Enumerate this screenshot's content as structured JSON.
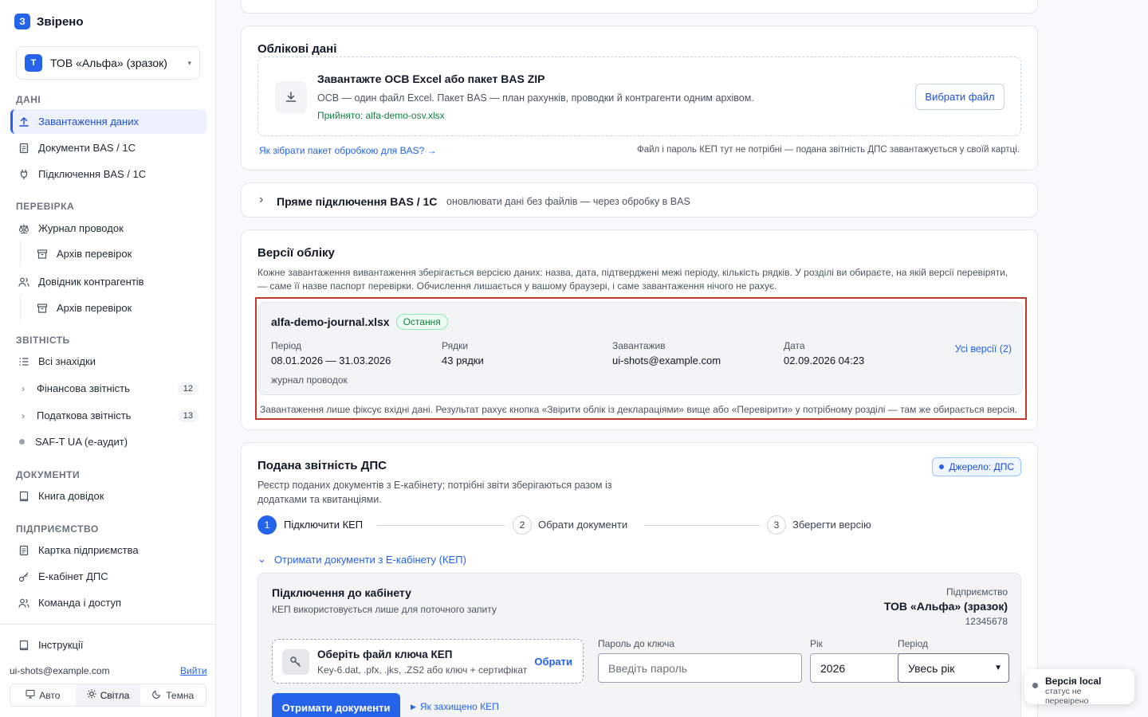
{
  "brand": {
    "logo_letter": "З",
    "name": "Звірено"
  },
  "org": {
    "avatar": "Т",
    "name": "ТОВ «Альфа» (зразок)"
  },
  "sidebar": {
    "sections": {
      "data": "ДАНІ",
      "check": "ПЕРЕВІРКА",
      "reporting": "ЗВІТНІСТЬ",
      "documents": "ДОКУМЕНТИ",
      "company": "ПІДПРИЄМСТВО"
    },
    "items": {
      "upload": "Завантаження даних",
      "bas_docs": "Документи BAS / 1С",
      "bas_connect": "Підключення BAS / 1С",
      "journal": "Журнал проводок",
      "archive1": "Архів перевірок",
      "counterparties": "Довідник контрагентів",
      "archive2": "Архів перевірок",
      "all_findings": "Всі знахідки",
      "financial": "Фінансова звітність",
      "financial_count": "12",
      "tax": "Податкова звітність",
      "tax_count": "13",
      "saft": "SAF-T UA (е-аудит)",
      "book": "Книга довідок",
      "company_card": "Картка підприємства",
      "ecabinet": "Е-кабінет ДПС",
      "team": "Команда і доступ",
      "instructions": "Інструкції"
    },
    "user_email": "ui-shots@example.com",
    "logout": "Вийти",
    "theme": {
      "auto": "Авто",
      "light": "Світла",
      "dark": "Темна"
    }
  },
  "accounting": {
    "title": "Облікові дані",
    "upload_title": "Завантажте ОСВ Excel або пакет BAS ZIP",
    "upload_desc": "ОСВ — один файл Excel. Пакет BAS — план рахунків, проводки й контрагенти одним архівом.",
    "accepted": "Прийнято: alfa-demo-osv.xlsx",
    "choose_file": "Вибрати файл",
    "how_link": "Як зібрати пакет обробкою для BAS? →",
    "note": "Файл і пароль КЕП тут не потрібні — подана звітність ДПС завантажується у своїй картці."
  },
  "direct": {
    "title": "Пряме підключення BAS / 1С",
    "subtitle": "оновлювати дані без файлів — через обробку в BAS"
  },
  "versions": {
    "title": "Версії обліку",
    "desc": "Кожне завантаження вивантаження зберігається версією даних: назва, дата, підтверджені межі періоду, кількість рядків. У розділі ви обираєте, на якій версії перевіряти, — саме її назве паспорт перевірки. Обчислення лишається у вашому браузері, і саме завантаження нічого не рахує.",
    "file": "alfa-demo-journal.xlsx",
    "tag": "Остання",
    "period_label": "Період",
    "period": "08.01.2026 — 31.03.2026",
    "rows_label": "Рядки",
    "rows": "43 рядки",
    "uploader_label": "Завантажив",
    "uploader": "ui-shots@example.com",
    "date_label": "Дата",
    "date": "02.09.2026 04:23",
    "all_versions": "Усі версії (2)",
    "type": "журнал проводок",
    "footer": "Завантаження лише фіксує вхідні дані. Результат рахує кнопка «Звірити облік із деклараціями» вище або «Перевірити» у потрібному розділі — там же обирається версія."
  },
  "dps": {
    "title": "Подана звітність ДПС",
    "desc": "Реєстр поданих документів з Е-кабінету; потрібні звіти зберігаються разом із додатками та квитанціями.",
    "source": "Джерело: ДПС",
    "steps": [
      {
        "num": "1",
        "label": "Підключити КЕП"
      },
      {
        "num": "2",
        "label": "Обрати документи"
      },
      {
        "num": "3",
        "label": "Зберегти версію"
      }
    ],
    "get_docs_toggle": "Отримати документи з Е-кабінету (КЕП)",
    "conn_title": "Підключення до кабінету",
    "conn_desc": "КЕП використовується лише для поточного запиту",
    "company_label": "Підприємство",
    "company_name": "ТОВ «Альфа» (зразок)",
    "company_code": "12345678",
    "key_title": "Оберіть файл ключа КЕП",
    "key_desc": "Key-6.dat, .pfx, .jks, .ZS2 або ключ + сертифікат",
    "key_choose": "Обрати",
    "password_label": "Пароль до ключа",
    "password_placeholder": "Введіть пароль",
    "year_label": "Рік",
    "year": "2026",
    "period_label": "Період",
    "period": "Увесь рік",
    "get_button": "Отримати документи",
    "protect_link": "Як захищено КЕП"
  },
  "toast": {
    "title": "Версія local",
    "subtitle": "статус не перевірено"
  }
}
